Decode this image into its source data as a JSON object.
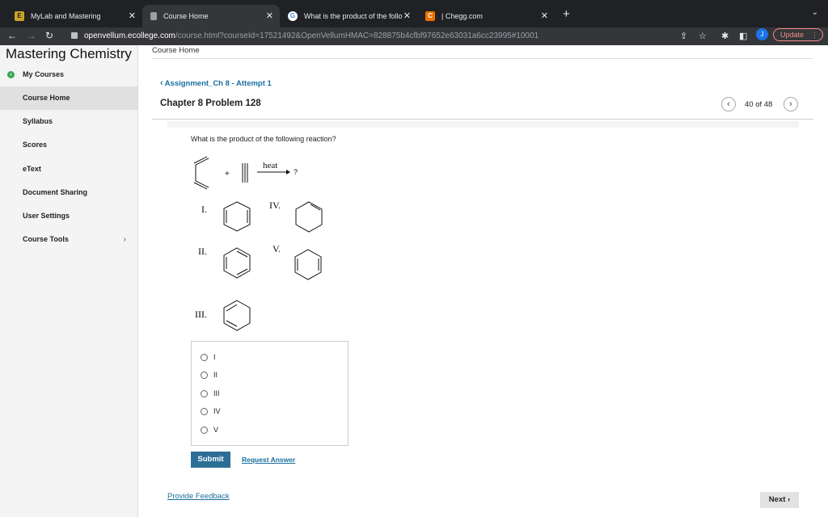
{
  "browser": {
    "tabs": [
      {
        "label": "MyLab and Mastering",
        "favicon": "mylab-icon"
      },
      {
        "label": "Course Home",
        "favicon": "page-icon"
      },
      {
        "label": "What is the product of the follo",
        "favicon": "google-icon"
      },
      {
        "label": "| Chegg.com",
        "favicon": "chegg-icon"
      }
    ],
    "url_host": "openvellum.ecollege.com",
    "url_path": "/course.html?courseId=17521492&OpenVellumHMAC=828875b4cfbf97652e63031a6cc23995#10001",
    "avatar_letter": "J",
    "update_label": "Update"
  },
  "sidebar": {
    "brand": "Mastering Chemistry",
    "items": [
      {
        "label": "My Courses"
      },
      {
        "label": "Course Home"
      },
      {
        "label": "Syllabus"
      },
      {
        "label": "Scores"
      },
      {
        "label": "eText"
      },
      {
        "label": "Document Sharing"
      },
      {
        "label": "User Settings"
      },
      {
        "label": "Course Tools"
      }
    ]
  },
  "main": {
    "breadcrumb": "Course Home",
    "assignment_link": "Assignment_Ch 8 - Attempt 1",
    "problem_title": "Chapter 8 Problem 128",
    "pager": {
      "current": "40 of 48"
    },
    "question": "What is the product of the following reaction?",
    "reaction": {
      "condition": "heat",
      "product": "?",
      "plus": "+"
    },
    "structures": {
      "I": "I.",
      "II": "II.",
      "III": "III.",
      "IV": "IV.",
      "V": "V."
    },
    "options": [
      "I",
      "II",
      "III",
      "IV",
      "V"
    ],
    "submit_label": "Submit",
    "request_answer_label": "Request Answer",
    "feedback_label": "Provide Feedback",
    "next_label": "Next"
  },
  "colors": {
    "brand_link": "#1a6ea0",
    "submit_bg": "#2d6e96",
    "active_nav": "#e0e0e0"
  }
}
